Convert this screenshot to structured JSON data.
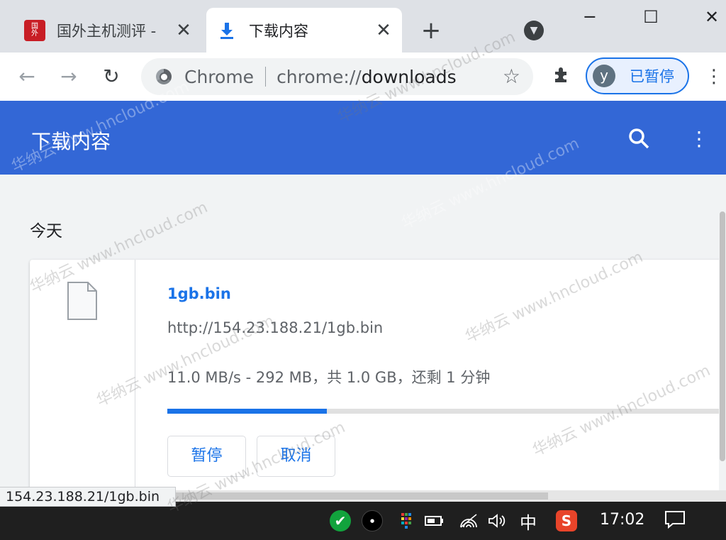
{
  "tabs": [
    {
      "title": "国外主机测评 - ",
      "icon": "site-logo-icon",
      "active": false
    },
    {
      "title": "下载内容",
      "icon": "download-arrow-icon",
      "active": true
    }
  ],
  "window": {
    "new_tab": "+",
    "minimize": "─",
    "maximize": "☐",
    "close": "✕"
  },
  "toolbar": {
    "origin": "Chrome",
    "url_prefix": "chrome://",
    "url_host": "downloads",
    "profile_initial": "y",
    "profile_label": "已暂停"
  },
  "page": {
    "title": "下载内容",
    "section_date": "今天"
  },
  "download": {
    "file_name": "1gb.bin",
    "url": "http://154.23.188.21/1gb.bin",
    "status": "11.0 MB/s - 292 MB，共 1.0 GB，还剩 1 分钟",
    "progress_fraction": 0.285,
    "pause_label": "暂停",
    "cancel_label": "取消"
  },
  "status_bubble": "154.23.188.21/1gb.bin",
  "taskbar": {
    "ime": "中",
    "sogou": "S",
    "time": "17:02"
  },
  "watermark": "华纳云 www.hncloud.com",
  "colors": {
    "accent": "#1a73e8",
    "header": "#3367d6",
    "taskbar": "#1f1f1f"
  }
}
